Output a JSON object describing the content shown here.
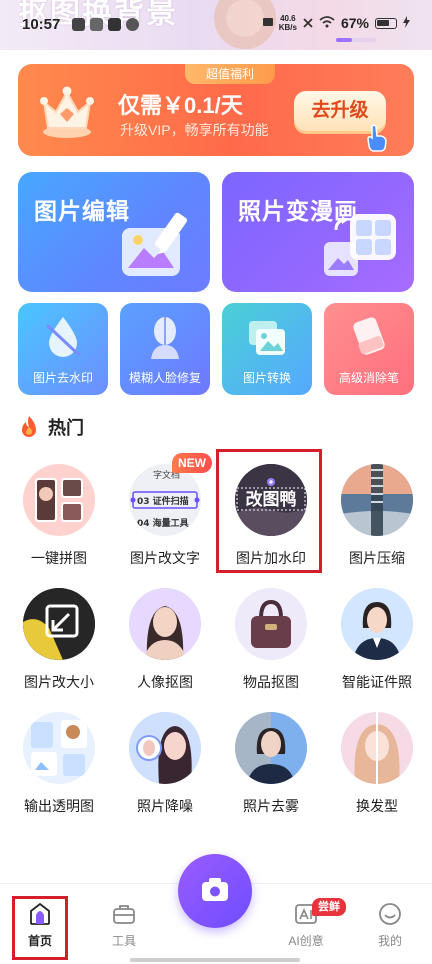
{
  "status": {
    "time": "10:57",
    "speed_top": "40.6",
    "speed_bottom": "KB/s",
    "battery": "67%"
  },
  "banner": {
    "text": "抠图换背景"
  },
  "vip": {
    "tag": "超值福利",
    "title": "仅需￥0.1/天",
    "subtitle": "升级VIP，畅享所有功能",
    "button": "去升级"
  },
  "big_cards": [
    {
      "label": "图片编辑"
    },
    {
      "label": "照片变漫画"
    }
  ],
  "tiles": [
    {
      "label": "图片去水印"
    },
    {
      "label": "模糊人脸修复"
    },
    {
      "label": "图片转换"
    },
    {
      "label": "高级消除笔"
    }
  ],
  "hot": {
    "title": "热门"
  },
  "features": [
    {
      "label": "一键拼图"
    },
    {
      "label": "图片改文字"
    },
    {
      "label": "图片加水印"
    },
    {
      "label": "图片压缩"
    },
    {
      "label": "图片改大小"
    },
    {
      "label": "人像抠图"
    },
    {
      "label": "物品抠图"
    },
    {
      "label": "智能证件照"
    },
    {
      "label": "输出透明图"
    },
    {
      "label": "照片降噪"
    },
    {
      "label": "照片去雾"
    },
    {
      "label": "换发型"
    }
  ],
  "thumb_text": {
    "doc_line1": "03 证件扫描",
    "doc_line2": "04 海量工具",
    "doc_top": "字文档",
    "watermark": "改图鸭"
  },
  "new_badge": "NEW",
  "nav": {
    "home": "首页",
    "tools": "工具",
    "ai": "AI创意",
    "ai_badge": "尝鲜",
    "mine": "我的"
  },
  "colors": {
    "accent": "#7b5cff",
    "highlight": "#d41e2a",
    "vip_orange": "#ff6a4a"
  }
}
